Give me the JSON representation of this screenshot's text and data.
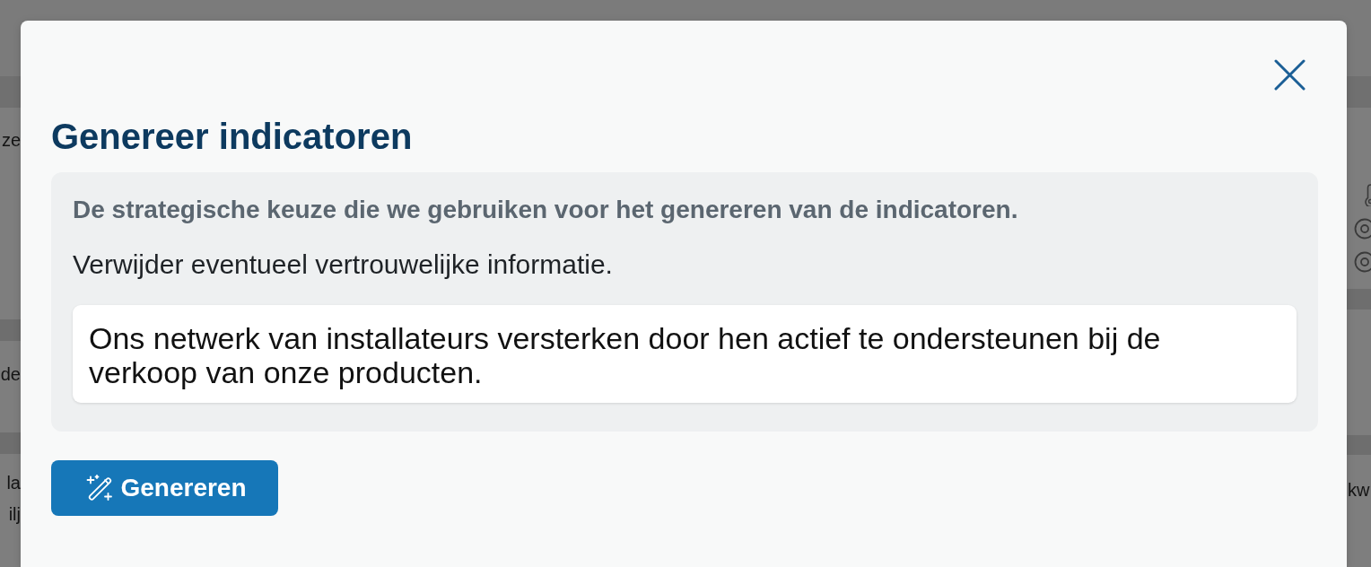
{
  "background_page": {
    "left_cards": [
      {
        "lines": [
          "ze"
        ]
      },
      {
        "lines": [
          "de"
        ]
      },
      {
        "lines": [
          "la",
          "ilj"
        ]
      }
    ],
    "right_text": "kw"
  },
  "dialog": {
    "title": "Genereer indicatoren",
    "panel": {
      "heading": "De strategische keuze die we gebruiken voor het genereren van de indicatoren.",
      "hint": "Verwijder eventueel vertrouwelijke informatie.",
      "text_area": {
        "value": "Ons netwerk van installateurs versterken door hen actief te ondersteunen bij de verkoop van onze producten."
      }
    },
    "generate_button": {
      "label": "Genereren"
    }
  }
}
